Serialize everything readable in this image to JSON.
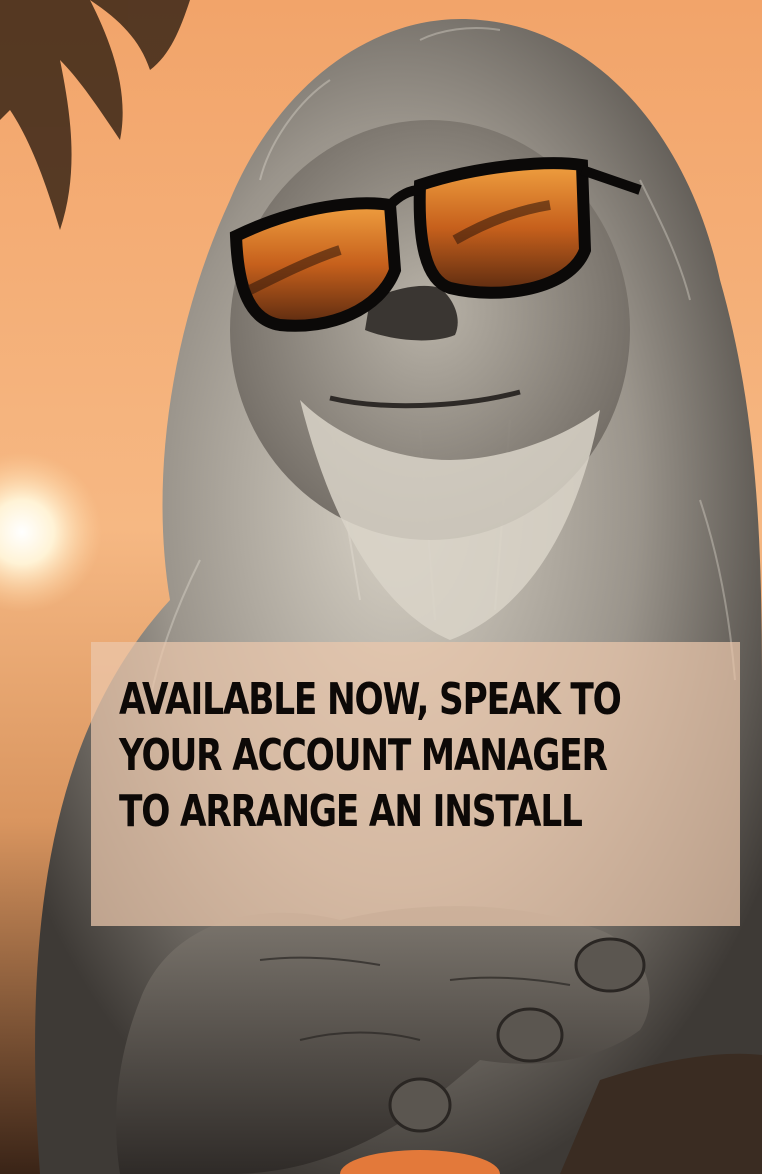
{
  "colors": {
    "sky_top": "#f3a66d",
    "sky_glow": "#ffd7a6",
    "fur_light": "#cfc9bd",
    "fur_dark": "#4f4b47",
    "lens": "#c8621f",
    "text": "#0d0907"
  },
  "scene": {
    "subject": "sasquatch-wearing-sunglasses",
    "elements": [
      "palm-leaf",
      "setting-sun",
      "sunglasses",
      "hand",
      "fruit"
    ]
  },
  "headline": {
    "lines": [
      "AVAILABLE NOW, SPEAK TO",
      "YOUR ACCOUNT MANAGER",
      "TO ARRANGE AN INSTALL"
    ]
  }
}
